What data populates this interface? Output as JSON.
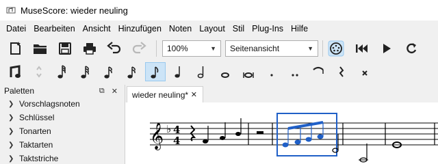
{
  "window": {
    "title": "MuseScore: wieder neuling"
  },
  "menu": [
    "Datei",
    "Bearbeiten",
    "Ansicht",
    "Hinzufügen",
    "Noten",
    "Layout",
    "Stil",
    "Plug-Ins",
    "Hilfe"
  ],
  "toolbar": {
    "zoom_value": "100%",
    "view_mode_value": "Seitenansicht"
  },
  "palettes": {
    "header": "Paletten",
    "items": [
      "Vorschlagsnoten",
      "Schlüssel",
      "Tonarten",
      "Taktarten",
      "Taktstriche"
    ]
  },
  "score_tabs": [
    {
      "label": "wieder neuling*"
    }
  ],
  "score": {
    "time_signature_top": "4",
    "time_signature_bottom": "4"
  },
  "colors": {
    "selection": "#1f5fc7",
    "accent_active": "#cce4f7"
  }
}
